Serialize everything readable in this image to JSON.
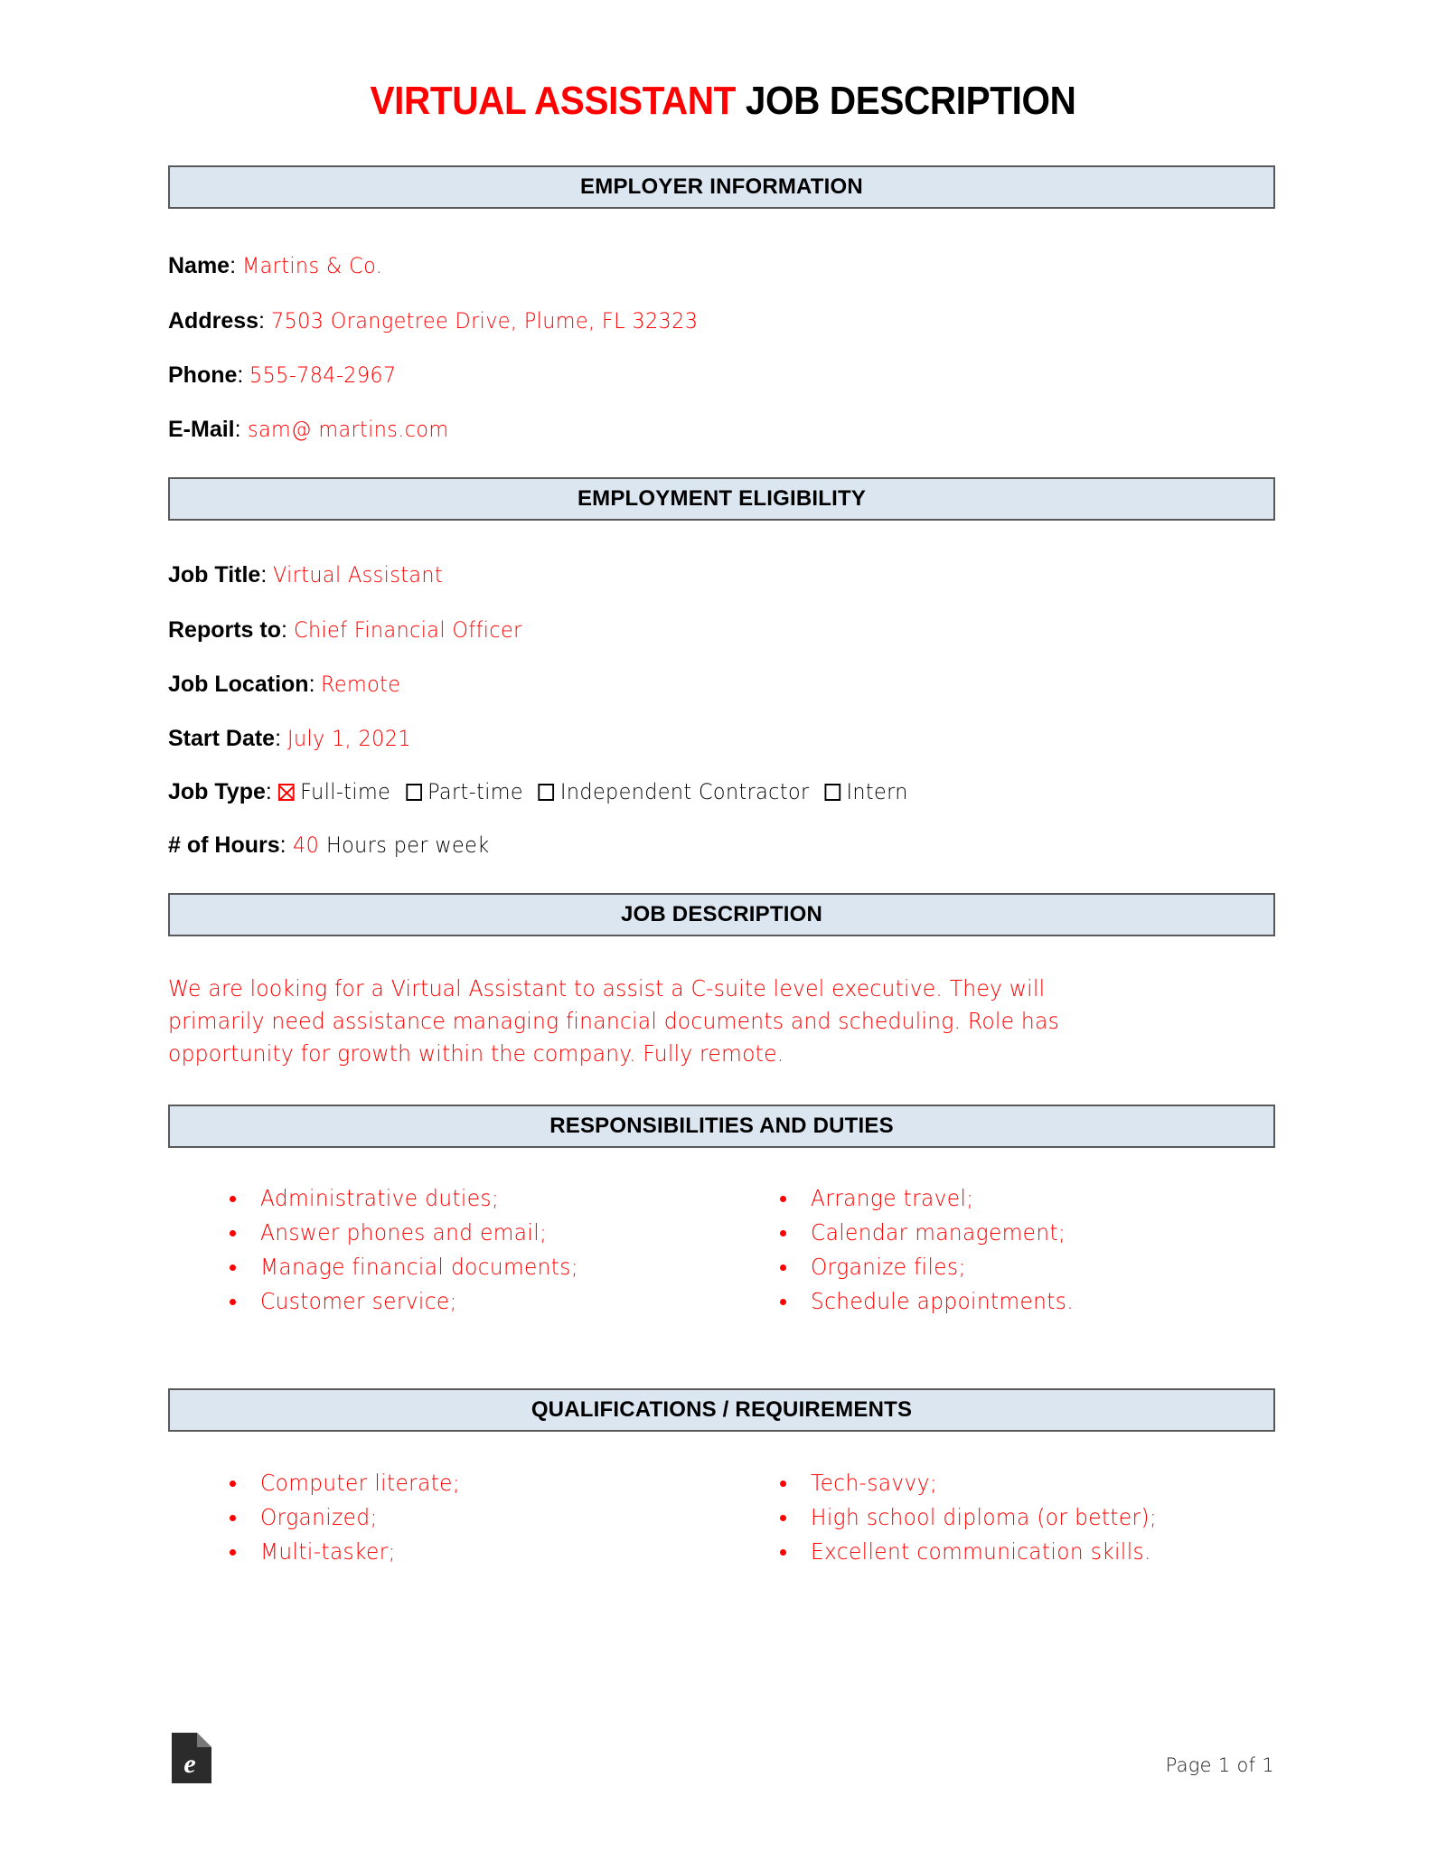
{
  "document": {
    "title_red": "VIRTUAL ASSISTANT",
    "title_black": "JOB DESCRIPTION"
  },
  "sections": {
    "employer_information": {
      "heading": "EMPLOYER INFORMATION",
      "fields": [
        {
          "label": "Name",
          "value": "Martins & Co."
        },
        {
          "label": "Address",
          "value": "7503 Orangetree Drive, Plume, FL 32323"
        },
        {
          "label": "Phone",
          "value": "555-784-2967"
        },
        {
          "label": "E-Mail",
          "value": "sam@ martins.com"
        }
      ]
    },
    "employment_eligibility": {
      "heading": "EMPLOYMENT ELIGIBILITY",
      "fields": [
        {
          "label": "Job Title",
          "value": "Virtual Assistant"
        },
        {
          "label": "Reports to",
          "value": "Chief Financial Officer"
        },
        {
          "label": "Job Location",
          "value": "Remote"
        },
        {
          "label": "Start Date",
          "value": "July 1, 2021"
        }
      ],
      "job_type": {
        "label": "Job Type",
        "options": [
          {
            "label": "Full-time",
            "checked": true
          },
          {
            "label": "Part-time",
            "checked": false
          },
          {
            "label": "Independent Contractor",
            "checked": false
          },
          {
            "label": "Intern",
            "checked": false
          }
        ]
      },
      "hours": {
        "label": "# of Hours",
        "value": "40",
        "suffix": "Hours per week"
      }
    },
    "job_description": {
      "heading": "JOB DESCRIPTION",
      "paragraph_lines": [
        "We are looking for a Virtual Assistant to assist a C-suite level executive. They will",
        "primarily need assistance managing financial documents and scheduling. Role has",
        "opportunity for growth within the company. Fully remote."
      ]
    },
    "responsibilities": {
      "heading": "RESPONSIBILITIES AND DUTIES",
      "left_column": [
        "Administrative duties;",
        "Answer phones and email;",
        "Manage financial documents;",
        "Customer service;"
      ],
      "right_column": [
        "Arrange travel;",
        "Calendar management;",
        "Organize files;",
        "Schedule appointments."
      ]
    },
    "qualifications": {
      "heading": "QUALIFICATIONS / REQUIREMENTS",
      "left_column": [
        "Computer literate;",
        "Organized;",
        "Multi-tasker;"
      ],
      "right_column": [
        "Tech-savvy;",
        "High school diploma (or better);",
        "Excellent communication skills."
      ]
    }
  },
  "footer": {
    "logo_letter": "e",
    "page_label": "Page 1 of 1"
  },
  "colors": {
    "fill_red": "#ff0000",
    "bar_fill": "#dce6f1",
    "bar_border": "#595959"
  }
}
